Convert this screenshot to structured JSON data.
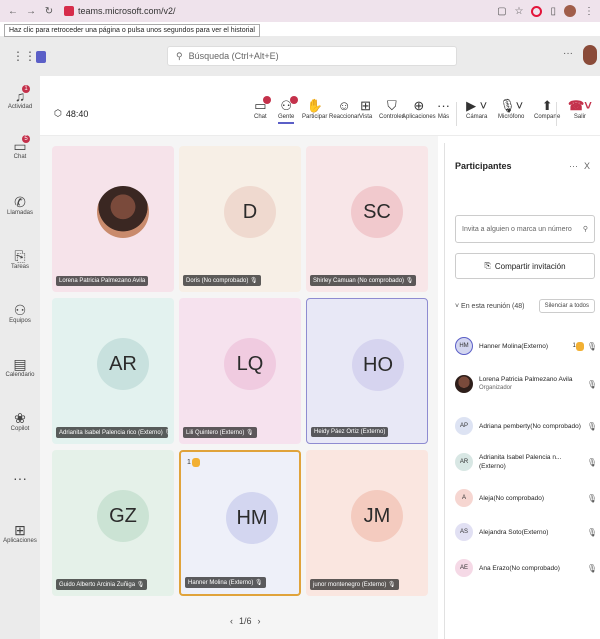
{
  "browser": {
    "url": "teams.microsoft.com/v2/",
    "tooltip": "Haz clic para retroceder una página o pulsa unos segundos para ver el historial"
  },
  "teams": {
    "search_placeholder": "Búsqueda (Ctrl+Alt+E)",
    "more": "···"
  },
  "rail": [
    {
      "label": "Actividad",
      "icon": "bell-icon",
      "badge": "1"
    },
    {
      "label": "Chat",
      "icon": "chat-icon",
      "badge": "5"
    },
    {
      "label": "Llamadas",
      "icon": "phone-icon",
      "badge": ""
    },
    {
      "label": "Tareas",
      "icon": "clipboard-icon",
      "badge": ""
    },
    {
      "label": "Equipos",
      "icon": "teams-icon",
      "badge": ""
    },
    {
      "label": "Calendario",
      "icon": "calendar-icon",
      "badge": ""
    },
    {
      "label": "Copilot",
      "icon": "copilot-icon",
      "badge": ""
    },
    {
      "label": "",
      "icon": "more-icon",
      "badge": ""
    },
    {
      "label": "Aplicaciones",
      "icon": "apps-icon",
      "badge": ""
    }
  ],
  "meeting": {
    "timer": "48:40",
    "tools": [
      {
        "label": "Chat",
        "icon": "chat-icon"
      },
      {
        "label": "Gente",
        "icon": "people-icon"
      },
      {
        "label": "Participar",
        "icon": "hand-icon"
      },
      {
        "label": "Reaccionar",
        "icon": "smile-icon"
      },
      {
        "label": "Vista",
        "icon": "grid-icon"
      },
      {
        "label": "Controles",
        "icon": "shield-icon"
      },
      {
        "label": "Aplicaciones",
        "icon": "plus-icon"
      },
      {
        "label": "Más",
        "icon": "ellipsis-icon"
      },
      {
        "label": "Cámara",
        "icon": "camera-off-icon"
      },
      {
        "label": "Micrófono",
        "icon": "mic-icon"
      },
      {
        "label": "Comparte",
        "icon": "share-icon"
      },
      {
        "label": "Salir",
        "icon": "leave-icon"
      }
    ]
  },
  "tiles": [
    {
      "initials": "",
      "name": "Lorena Patricia Palmezano Avila",
      "bg": "#f6e3ea",
      "avatar": "photo"
    },
    {
      "initials": "D",
      "name": "Doris (No comprobado)",
      "bg": "#f7efe6",
      "avatar": "#efd9cf"
    },
    {
      "initials": "SC",
      "name": "Shirley Camuan (No comprobado)",
      "bg": "#f8e6e8",
      "avatar": "#f1c9cd"
    },
    {
      "initials": "AR",
      "name": "Adrianita Isabel Palencia rico (Externo)",
      "bg": "#e3f2ef",
      "avatar": "#c8e1de"
    },
    {
      "initials": "LQ",
      "name": "Lili Quintero (Externo)",
      "bg": "#f6e2ee",
      "avatar": "#f0cbe0"
    },
    {
      "initials": "HO",
      "name": "Heidy Páez Ortiz (Externo)",
      "bg": "#e8e8f6",
      "avatar": "#d6d4ef"
    },
    {
      "initials": "GZ",
      "name": "Guido Alberto Arcinia Zuñiga",
      "bg": "#e5f1e9",
      "avatar": "#cbe3d4"
    },
    {
      "initials": "HM",
      "name": "Hanner Molina (Externo)",
      "bg": "#eef0f9",
      "avatar": "#d3d6f0",
      "reaction": "1"
    },
    {
      "initials": "JM",
      "name": "junor montenegro (Externo)",
      "bg": "#fae6e0",
      "avatar": "#f4cbbf"
    }
  ],
  "pager": {
    "prev": "‹",
    "label": "1/6",
    "next": "›"
  },
  "panel": {
    "title": "Participantes",
    "more": "···",
    "close": "X",
    "invite_placeholder": "Invita a alguien o marca un número",
    "share_label": "Compartir invitación",
    "section_label": "En esta reunión (48)",
    "mute_all": "Silenciar a todos",
    "participants": [
      {
        "initials": "HM",
        "name": "Hanner Molina(Externo)",
        "sub": "",
        "color": "#d3d6f0",
        "ring": true,
        "hand": true,
        "count": "1"
      },
      {
        "initials": "",
        "name": "Lorena Patricia Palmezano Avila",
        "sub": "Organizador",
        "color": "photo",
        "ring": false,
        "hand": false,
        "count": ""
      },
      {
        "initials": "AP",
        "name": "Adriana pemberty(No comprobado)",
        "sub": "",
        "color": "#dde3f3",
        "ring": false,
        "hand": false,
        "count": ""
      },
      {
        "initials": "AR",
        "name": "Adrianita Isabel Palencia n... (Externo)",
        "sub": "",
        "color": "#d8e7e4",
        "ring": false,
        "hand": false,
        "count": ""
      },
      {
        "initials": "A",
        "name": "Aleja(No comprobado)",
        "sub": "",
        "color": "#f6d6d1",
        "ring": false,
        "hand": false,
        "count": ""
      },
      {
        "initials": "AS",
        "name": "Alejandra Soto(Externo)",
        "sub": "",
        "color": "#e1e0f3",
        "ring": false,
        "hand": false,
        "count": ""
      },
      {
        "initials": "AE",
        "name": "Ana Erazo(No comprobado)",
        "sub": "",
        "color": "#f5d9e6",
        "ring": false,
        "hand": false,
        "count": ""
      }
    ]
  }
}
